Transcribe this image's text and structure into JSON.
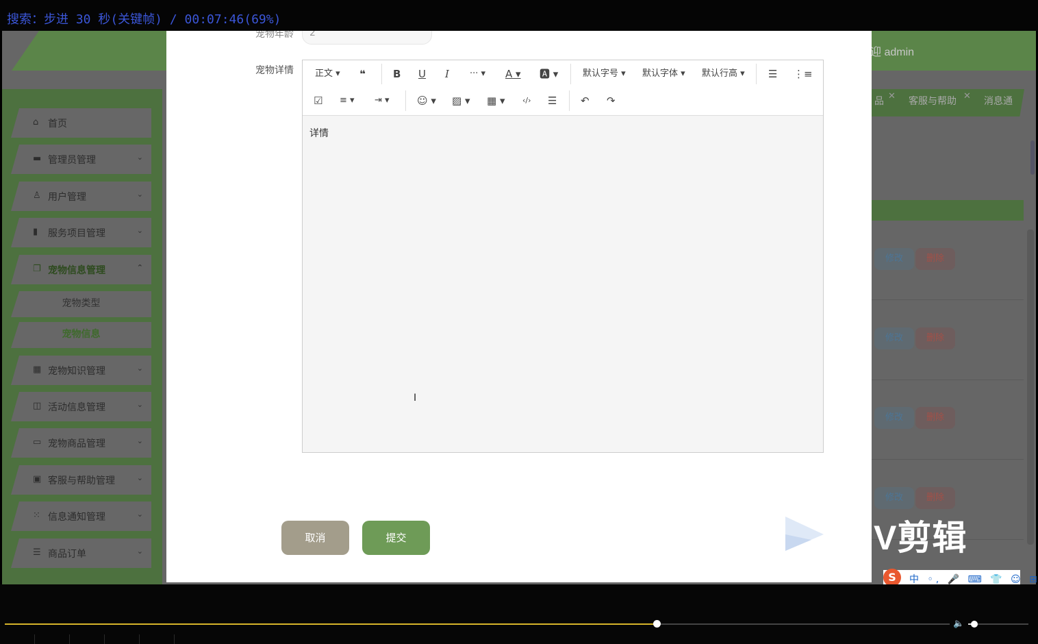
{
  "osd": {
    "text": "搜索：步进 30 秒(关键帧) / 00:07:46(69%)"
  },
  "header": {
    "welcome": "迎 admin"
  },
  "tabs": [
    {
      "label": "品"
    },
    {
      "label": "客服与帮助"
    },
    {
      "label": "消息通"
    }
  ],
  "sidebar": {
    "items": [
      {
        "label": "首页",
        "icon": "home-icon"
      },
      {
        "label": "管理员管理",
        "icon": "card-icon"
      },
      {
        "label": "用户管理",
        "icon": "user-icon"
      },
      {
        "label": "服务项目管理",
        "icon": "bookmark-icon"
      },
      {
        "label": "宠物信息管理",
        "icon": "copy-icon"
      },
      {
        "label": "宠物知识管理",
        "icon": "grid-icon"
      },
      {
        "label": "活动信息管理",
        "icon": "columns-icon"
      },
      {
        "label": "宠物商品管理",
        "icon": "box-icon"
      },
      {
        "label": "客服与帮助管理",
        "icon": "image-icon"
      },
      {
        "label": "信息通知管理",
        "icon": "apps-icon"
      },
      {
        "label": "商品订单",
        "icon": "server-icon"
      }
    ],
    "sub_items": [
      {
        "label": "宠物类型"
      },
      {
        "label": "宠物信息"
      }
    ]
  },
  "table": {
    "rows": [
      {
        "edit": "修改",
        "delete": "删除"
      },
      {
        "edit": "修改",
        "delete": "删除"
      },
      {
        "edit": "修改",
        "delete": "删除"
      },
      {
        "edit": "修改",
        "delete": "删除"
      }
    ]
  },
  "form": {
    "age_label": "宠物年龄",
    "age_value": "2",
    "detail_label": "宠物详情",
    "editor": {
      "toolbar": {
        "paragraph": "正文",
        "font_size": "默认字号",
        "font_family": "默认字体",
        "line_height": "默认行高"
      },
      "content": "详情"
    },
    "cancel_label": "取消",
    "submit_label": "提交"
  },
  "watermark": {
    "text": "V剪辑"
  },
  "ime": {
    "s": "S",
    "text": "中 ◦, 🎤 ⌨ 👕 ☺ ⊞"
  },
  "player": {
    "progress": 0.69,
    "volume": 0.1
  },
  "colors": {
    "header_green": "#5b8549",
    "submit_green": "#6e9b57",
    "cancel_gray": "#a39d8b",
    "osd_blue": "#3b56d8"
  }
}
